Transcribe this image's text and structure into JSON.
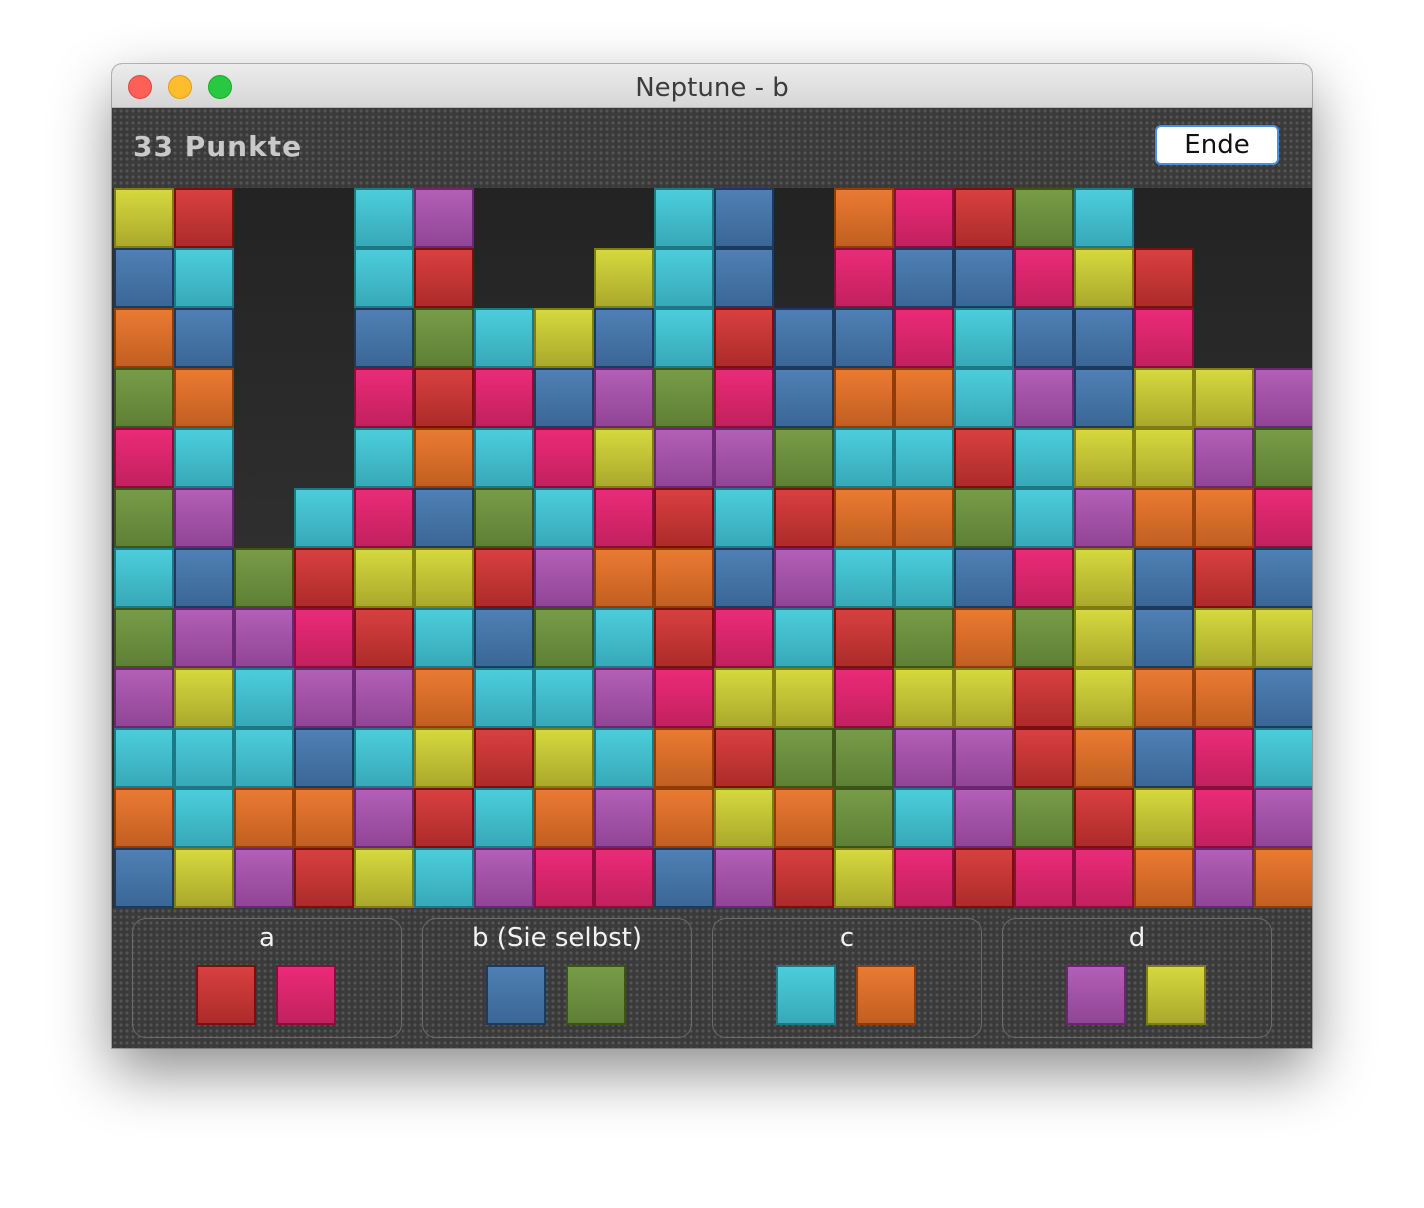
{
  "window": {
    "title": "Neptune - b"
  },
  "header": {
    "score": "33 Punkte",
    "end_button": "Ende"
  },
  "colors": {
    "yellow": "#c4c536",
    "red": "#c33635",
    "cyan": "#42bccb",
    "purple": "#a252a6",
    "blue": "#4574a6",
    "orange": "#d96c29",
    "green": "#6b8e3e",
    "pink": "#d8256b"
  },
  "board": {
    "columns": 20,
    "rows": [
      [
        "yellow",
        "red",
        null,
        null,
        "cyan",
        "purple",
        null,
        null,
        null,
        "cyan",
        "blue",
        null,
        "orange",
        "pink",
        "red",
        "green",
        "cyan",
        null,
        null,
        null
      ],
      [
        "blue",
        "cyan",
        null,
        null,
        "cyan",
        "red",
        null,
        null,
        "yellow",
        "cyan",
        "blue",
        null,
        "pink",
        "blue",
        "blue",
        "pink",
        "yellow",
        "red",
        null,
        null
      ],
      [
        "orange",
        "blue",
        null,
        null,
        "blue",
        "green",
        "cyan",
        "yellow",
        "blue",
        "cyan",
        "red",
        "blue",
        "blue",
        "pink",
        "cyan",
        "blue",
        "blue",
        "pink",
        null,
        null
      ],
      [
        "green",
        "orange",
        null,
        null,
        "pink",
        "red",
        "pink",
        "blue",
        "purple",
        "green",
        "pink",
        "blue",
        "orange",
        "orange",
        "cyan",
        "purple",
        "blue",
        "yellow",
        "yellow",
        "purple"
      ],
      [
        "pink",
        "cyan",
        null,
        null,
        "cyan",
        "orange",
        "cyan",
        "pink",
        "yellow",
        "purple",
        "purple",
        "green",
        "cyan",
        "cyan",
        "red",
        "cyan",
        "yellow",
        "yellow",
        "purple",
        "green"
      ],
      [
        "green",
        "purple",
        null,
        "cyan",
        "pink",
        "blue",
        "green",
        "cyan",
        "pink",
        "red",
        "cyan",
        "red",
        "orange",
        "orange",
        "green",
        "cyan",
        "purple",
        "orange",
        "orange",
        "pink"
      ],
      [
        "cyan",
        "blue",
        "green",
        "red",
        "yellow",
        "yellow",
        "red",
        "purple",
        "orange",
        "orange",
        "blue",
        "purple",
        "cyan",
        "cyan",
        "blue",
        "pink",
        "yellow",
        "blue",
        "red",
        "blue"
      ],
      [
        "green",
        "purple",
        "purple",
        "pink",
        "red",
        "cyan",
        "blue",
        "green",
        "cyan",
        "red",
        "pink",
        "cyan",
        "red",
        "green",
        "orange",
        "green",
        "yellow",
        "blue",
        "yellow",
        "yellow"
      ],
      [
        "purple",
        "yellow",
        "cyan",
        "purple",
        "purple",
        "orange",
        "cyan",
        "cyan",
        "purple",
        "pink",
        "yellow",
        "yellow",
        "pink",
        "yellow",
        "yellow",
        "red",
        "yellow",
        "orange",
        "orange",
        "blue"
      ],
      [
        "cyan",
        "cyan",
        "cyan",
        "blue",
        "cyan",
        "yellow",
        "red",
        "yellow",
        "cyan",
        "orange",
        "red",
        "green",
        "green",
        "purple",
        "purple",
        "red",
        "orange",
        "blue",
        "pink",
        "cyan"
      ],
      [
        "orange",
        "cyan",
        "orange",
        "orange",
        "purple",
        "red",
        "cyan",
        "orange",
        "purple",
        "orange",
        "yellow",
        "orange",
        "green",
        "cyan",
        "purple",
        "green",
        "red",
        "yellow",
        "pink",
        "purple"
      ],
      [
        "blue",
        "yellow",
        "purple",
        "red",
        "yellow",
        "cyan",
        "purple",
        "pink",
        "pink",
        "blue",
        "purple",
        "red",
        "yellow",
        "pink",
        "red",
        "pink",
        "pink",
        "orange",
        "purple",
        "orange"
      ]
    ]
  },
  "players": [
    {
      "label": "a",
      "colors": [
        "red",
        "pink"
      ]
    },
    {
      "label": "b (Sie selbst)",
      "colors": [
        "blue",
        "green"
      ]
    },
    {
      "label": "c",
      "colors": [
        "cyan",
        "orange"
      ]
    },
    {
      "label": "d",
      "colors": [
        "purple",
        "yellow"
      ]
    }
  ]
}
